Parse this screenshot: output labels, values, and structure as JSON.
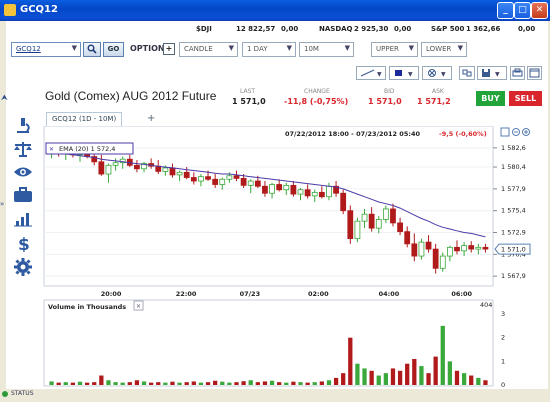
{
  "window": {
    "title": "GCQ12",
    "buttons": [
      "minimize",
      "maximize",
      "close"
    ]
  },
  "quotes": [
    {
      "name": "$DJI",
      "value": "12 822,57",
      "change": "0,00"
    },
    {
      "name": "NASDAQ",
      "value": "2 925,30",
      "change": "0,00"
    },
    {
      "name": "S&P 500",
      "value": "1 362,66",
      "change": "0,00"
    }
  ],
  "toolbar": {
    "symbol": "GCQ12",
    "go_label": "GO",
    "option_label": "OPTION",
    "chart_type": "CANDLE",
    "period": "1 DAY",
    "interval": "10M",
    "upper": "UPPER",
    "lower": "LOWER"
  },
  "instrument": {
    "name": "Gold (Comex) AUG 2012 Future",
    "last_label": "LAST",
    "last": "1 571,0",
    "change_label": "CHANGE",
    "change": "-11,8 (-0,75%)",
    "bid_label": "BID",
    "bid": "1 571,0",
    "ask_label": "ASK",
    "ask": "1 571,2",
    "buy_label": "BUY",
    "sell_label": "SELL",
    "colors": {
      "buy": "#22a43a",
      "sell": "#d8262c",
      "negative": "#d8262c"
    }
  },
  "side_icons": [
    "microscope-icon",
    "scales-icon",
    "eye-icon",
    "briefcase-icon",
    "bar-chart-icon",
    "dollar-icon",
    "gear-icon"
  ],
  "tabs": [
    {
      "label": "GCQ12 (1D - 10M)"
    }
  ],
  "add_tab_label": "+",
  "chart": {
    "date_range": "07/22/2012 18:00 - 07/23/2012 05:40",
    "range_change": "-9,5 (-0,60%)",
    "ema_label": "EMA (20) 1 572,4",
    "price_ticks": [
      "1 582,6",
      "1 580,4",
      "1 577,9",
      "1 575,4",
      "1 572,9",
      "1 570,4",
      "1 567,9"
    ],
    "last_price_tag": "1 571,0",
    "time_ticks": [
      "20:00",
      "22:00",
      "07/23",
      "02:00",
      "04:00",
      "06:00"
    ],
    "volume_title": "Volume in Thousands",
    "volume_max_label": "404",
    "volume_ticks": [
      "3",
      "2",
      "1",
      "0"
    ],
    "status_label": "STATUS"
  },
  "chart_data": {
    "type": "candlestick",
    "ylim": [
      1567.0,
      1583.5
    ],
    "y_ticks": [
      1582.6,
      1580.4,
      1577.9,
      1575.4,
      1572.9,
      1570.4,
      1567.9
    ],
    "last": 1571.0,
    "candles": [
      {
        "o": 1582.0,
        "h": 1582.8,
        "l": 1581.4,
        "c": 1582.5
      },
      {
        "o": 1582.4,
        "h": 1582.9,
        "l": 1581.6,
        "c": 1581.9
      },
      {
        "o": 1581.9,
        "h": 1582.6,
        "l": 1581.2,
        "c": 1582.2
      },
      {
        "o": 1582.1,
        "h": 1582.7,
        "l": 1581.5,
        "c": 1581.8
      },
      {
        "o": 1581.8,
        "h": 1582.4,
        "l": 1581.0,
        "c": 1582.0
      },
      {
        "o": 1582.0,
        "h": 1582.6,
        "l": 1581.4,
        "c": 1581.6
      },
      {
        "o": 1581.6,
        "h": 1582.2,
        "l": 1580.6,
        "c": 1581.0
      },
      {
        "o": 1581.0,
        "h": 1581.8,
        "l": 1579.4,
        "c": 1579.6
      },
      {
        "o": 1579.6,
        "h": 1580.8,
        "l": 1578.6,
        "c": 1580.6
      },
      {
        "o": 1580.6,
        "h": 1581.4,
        "l": 1580.0,
        "c": 1580.9
      },
      {
        "o": 1580.9,
        "h": 1581.6,
        "l": 1580.2,
        "c": 1581.3
      },
      {
        "o": 1581.3,
        "h": 1581.8,
        "l": 1580.4,
        "c": 1580.6
      },
      {
        "o": 1580.6,
        "h": 1581.2,
        "l": 1579.8,
        "c": 1580.2
      },
      {
        "o": 1580.2,
        "h": 1581.0,
        "l": 1579.8,
        "c": 1580.8
      },
      {
        "o": 1580.8,
        "h": 1581.4,
        "l": 1580.2,
        "c": 1580.5
      },
      {
        "o": 1580.5,
        "h": 1581.2,
        "l": 1579.6,
        "c": 1579.9
      },
      {
        "o": 1579.9,
        "h": 1580.6,
        "l": 1579.4,
        "c": 1580.3
      },
      {
        "o": 1580.3,
        "h": 1580.8,
        "l": 1579.2,
        "c": 1579.5
      },
      {
        "o": 1579.5,
        "h": 1580.0,
        "l": 1578.8,
        "c": 1579.8
      },
      {
        "o": 1579.8,
        "h": 1580.4,
        "l": 1579.0,
        "c": 1579.2
      },
      {
        "o": 1579.2,
        "h": 1579.8,
        "l": 1578.4,
        "c": 1578.8
      },
      {
        "o": 1578.8,
        "h": 1579.6,
        "l": 1578.2,
        "c": 1579.3
      },
      {
        "o": 1579.3,
        "h": 1580.0,
        "l": 1578.8,
        "c": 1579.0
      },
      {
        "o": 1579.0,
        "h": 1579.6,
        "l": 1578.0,
        "c": 1578.4
      },
      {
        "o": 1578.4,
        "h": 1579.2,
        "l": 1577.8,
        "c": 1579.0
      },
      {
        "o": 1579.0,
        "h": 1579.8,
        "l": 1578.6,
        "c": 1579.4
      },
      {
        "o": 1579.4,
        "h": 1580.0,
        "l": 1578.8,
        "c": 1579.1
      },
      {
        "o": 1579.1,
        "h": 1579.6,
        "l": 1578.0,
        "c": 1578.3
      },
      {
        "o": 1578.3,
        "h": 1579.0,
        "l": 1577.4,
        "c": 1578.8
      },
      {
        "o": 1578.8,
        "h": 1579.4,
        "l": 1578.0,
        "c": 1578.2
      },
      {
        "o": 1578.2,
        "h": 1578.8,
        "l": 1577.0,
        "c": 1577.4
      },
      {
        "o": 1577.4,
        "h": 1578.6,
        "l": 1576.8,
        "c": 1578.4
      },
      {
        "o": 1578.4,
        "h": 1579.0,
        "l": 1577.6,
        "c": 1577.8
      },
      {
        "o": 1577.8,
        "h": 1578.6,
        "l": 1577.2,
        "c": 1578.3
      },
      {
        "o": 1578.3,
        "h": 1578.8,
        "l": 1577.0,
        "c": 1577.3
      },
      {
        "o": 1577.3,
        "h": 1578.0,
        "l": 1576.6,
        "c": 1577.8
      },
      {
        "o": 1577.8,
        "h": 1578.4,
        "l": 1576.8,
        "c": 1577.1
      },
      {
        "o": 1577.1,
        "h": 1577.8,
        "l": 1576.4,
        "c": 1577.5
      },
      {
        "o": 1577.5,
        "h": 1578.2,
        "l": 1576.8,
        "c": 1577.0
      },
      {
        "o": 1577.0,
        "h": 1578.6,
        "l": 1576.6,
        "c": 1578.2
      },
      {
        "o": 1578.2,
        "h": 1578.8,
        "l": 1577.0,
        "c": 1577.4
      },
      {
        "o": 1577.4,
        "h": 1577.8,
        "l": 1575.0,
        "c": 1575.4
      },
      {
        "o": 1575.4,
        "h": 1576.0,
        "l": 1571.6,
        "c": 1572.2
      },
      {
        "o": 1572.2,
        "h": 1574.6,
        "l": 1571.8,
        "c": 1574.2
      },
      {
        "o": 1574.2,
        "h": 1575.6,
        "l": 1573.4,
        "c": 1575.0
      },
      {
        "o": 1575.0,
        "h": 1575.8,
        "l": 1573.0,
        "c": 1573.4
      },
      {
        "o": 1573.4,
        "h": 1574.8,
        "l": 1572.8,
        "c": 1574.4
      },
      {
        "o": 1574.4,
        "h": 1576.0,
        "l": 1574.0,
        "c": 1575.6
      },
      {
        "o": 1575.6,
        "h": 1576.2,
        "l": 1573.6,
        "c": 1574.0
      },
      {
        "o": 1574.0,
        "h": 1574.6,
        "l": 1572.6,
        "c": 1573.0
      },
      {
        "o": 1573.0,
        "h": 1573.6,
        "l": 1571.2,
        "c": 1571.6
      },
      {
        "o": 1571.6,
        "h": 1572.8,
        "l": 1569.6,
        "c": 1570.2
      },
      {
        "o": 1570.2,
        "h": 1572.2,
        "l": 1569.8,
        "c": 1571.8
      },
      {
        "o": 1571.8,
        "h": 1572.6,
        "l": 1570.6,
        "c": 1571.0
      },
      {
        "o": 1571.0,
        "h": 1571.6,
        "l": 1568.2,
        "c": 1568.8
      },
      {
        "o": 1568.8,
        "h": 1570.6,
        "l": 1568.4,
        "c": 1570.2
      },
      {
        "o": 1570.2,
        "h": 1571.4,
        "l": 1569.6,
        "c": 1571.2
      },
      {
        "o": 1571.2,
        "h": 1572.0,
        "l": 1570.4,
        "c": 1570.8
      },
      {
        "o": 1570.8,
        "h": 1571.8,
        "l": 1570.2,
        "c": 1571.4
      },
      {
        "o": 1571.4,
        "h": 1571.9,
        "l": 1570.6,
        "c": 1571.0
      },
      {
        "o": 1571.0,
        "h": 1571.6,
        "l": 1570.4,
        "c": 1571.2
      },
      {
        "o": 1571.2,
        "h": 1571.6,
        "l": 1570.6,
        "c": 1571.0
      }
    ],
    "ema": [
      1582.0,
      1581.9,
      1581.9,
      1581.8,
      1581.7,
      1581.6,
      1581.5,
      1581.3,
      1581.2,
      1581.1,
      1581.0,
      1580.9,
      1580.8,
      1580.7,
      1580.6,
      1580.5,
      1580.4,
      1580.3,
      1580.2,
      1580.1,
      1580.0,
      1579.9,
      1579.8,
      1579.7,
      1579.6,
      1579.6,
      1579.5,
      1579.4,
      1579.3,
      1579.2,
      1579.1,
      1579.0,
      1578.9,
      1578.8,
      1578.7,
      1578.6,
      1578.5,
      1578.4,
      1578.3,
      1578.2,
      1578.1,
      1577.9,
      1577.6,
      1577.3,
      1577.0,
      1576.7,
      1576.4,
      1576.2,
      1576.0,
      1575.7,
      1575.3,
      1574.9,
      1574.5,
      1574.2,
      1573.8,
      1573.5,
      1573.3,
      1573.1,
      1572.9,
      1572.8,
      1572.6,
      1572.4
    ],
    "volume_ylim": [
      0,
      3
    ],
    "volume_thousands": [
      0.15,
      0.1,
      0.12,
      0.1,
      0.14,
      0.1,
      0.12,
      0.4,
      0.2,
      0.12,
      0.1,
      0.12,
      0.2,
      0.15,
      0.1,
      0.12,
      0.1,
      0.14,
      0.1,
      0.12,
      0.15,
      0.1,
      0.12,
      0.18,
      0.14,
      0.1,
      0.12,
      0.16,
      0.2,
      0.12,
      0.15,
      0.18,
      0.12,
      0.1,
      0.14,
      0.12,
      0.1,
      0.12,
      0.15,
      0.2,
      0.3,
      0.5,
      2.0,
      0.9,
      0.7,
      0.6,
      0.4,
      0.5,
      0.7,
      0.6,
      0.9,
      1.1,
      0.8,
      0.5,
      1.2,
      2.5,
      1.0,
      0.6,
      0.5,
      0.4,
      0.3,
      0.2
    ]
  }
}
